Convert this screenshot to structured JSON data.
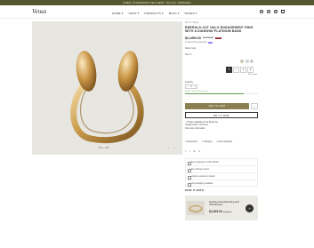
{
  "promo": {
    "text": "FREE STANDARD DELIVERY ON ALL ORDERS"
  },
  "header": {
    "logo": "Venus",
    "nav": [
      "HOME ▾",
      "SHOP ▾",
      "PRODUCTS ▾",
      "BLOG ▾",
      "PAGES ▾"
    ]
  },
  "gallery": {
    "counter": "1/3 — 1/3",
    "prev": "‹",
    "next": "›"
  },
  "product": {
    "breadcrumb": "Home / Rings",
    "title": "EMERALD-CUT HALO ENGAGEMENT RING WITH A DIAMOND PLATINUM BAND",
    "price": "$2,499.00",
    "price_old": "$2,999.00",
    "sale_badge": "-17%",
    "installments": "4 interest-free payments",
    "pay_badge": "Pay",
    "color_label": "Metal: Gold",
    "size_label": "Size: 6",
    "sizes": [
      "6",
      "7",
      "8",
      "9"
    ],
    "size_guide": "Size guide",
    "qty_label": "Quantity",
    "qty_minus": "−",
    "qty_value": "1",
    "qty_plus": "+",
    "stock_text": "Hurry! Only 10 left in stock",
    "stock_fraction": 0.8,
    "add_to_cart": "ADD TO CART",
    "wishlist": "♡",
    "buy_now": "BUY IT NOW",
    "pickup_line1": "✓ Pickup available at The Rings Ave",
    "pickup_line2": "Usually ready in 24 hours",
    "pickup_line3": "View store information",
    "links": [
      "◇ Description",
      "◇ Shipping",
      "◇ Ask a Question"
    ],
    "share": [
      "f",
      "t",
      "✉",
      "p"
    ],
    "features": [
      "Free shipping on orders $150+",
      "Free 30-day returns",
      "Lifetime warranty included",
      "Gift packaging available"
    ]
  },
  "colors": {
    "accent": "#8a7f50",
    "promo_bg": "#54572d",
    "swatches": [
      "#d7b56d",
      "#e3e3e3",
      "#e8c7b8"
    ]
  },
  "pair": {
    "title": "PAIR IT WITH",
    "name": "Sparkling Infinity Band Ring Gold Chain Bracelet",
    "price": "$2,499.00",
    "price_old": "$2,999.00",
    "add": "+"
  }
}
